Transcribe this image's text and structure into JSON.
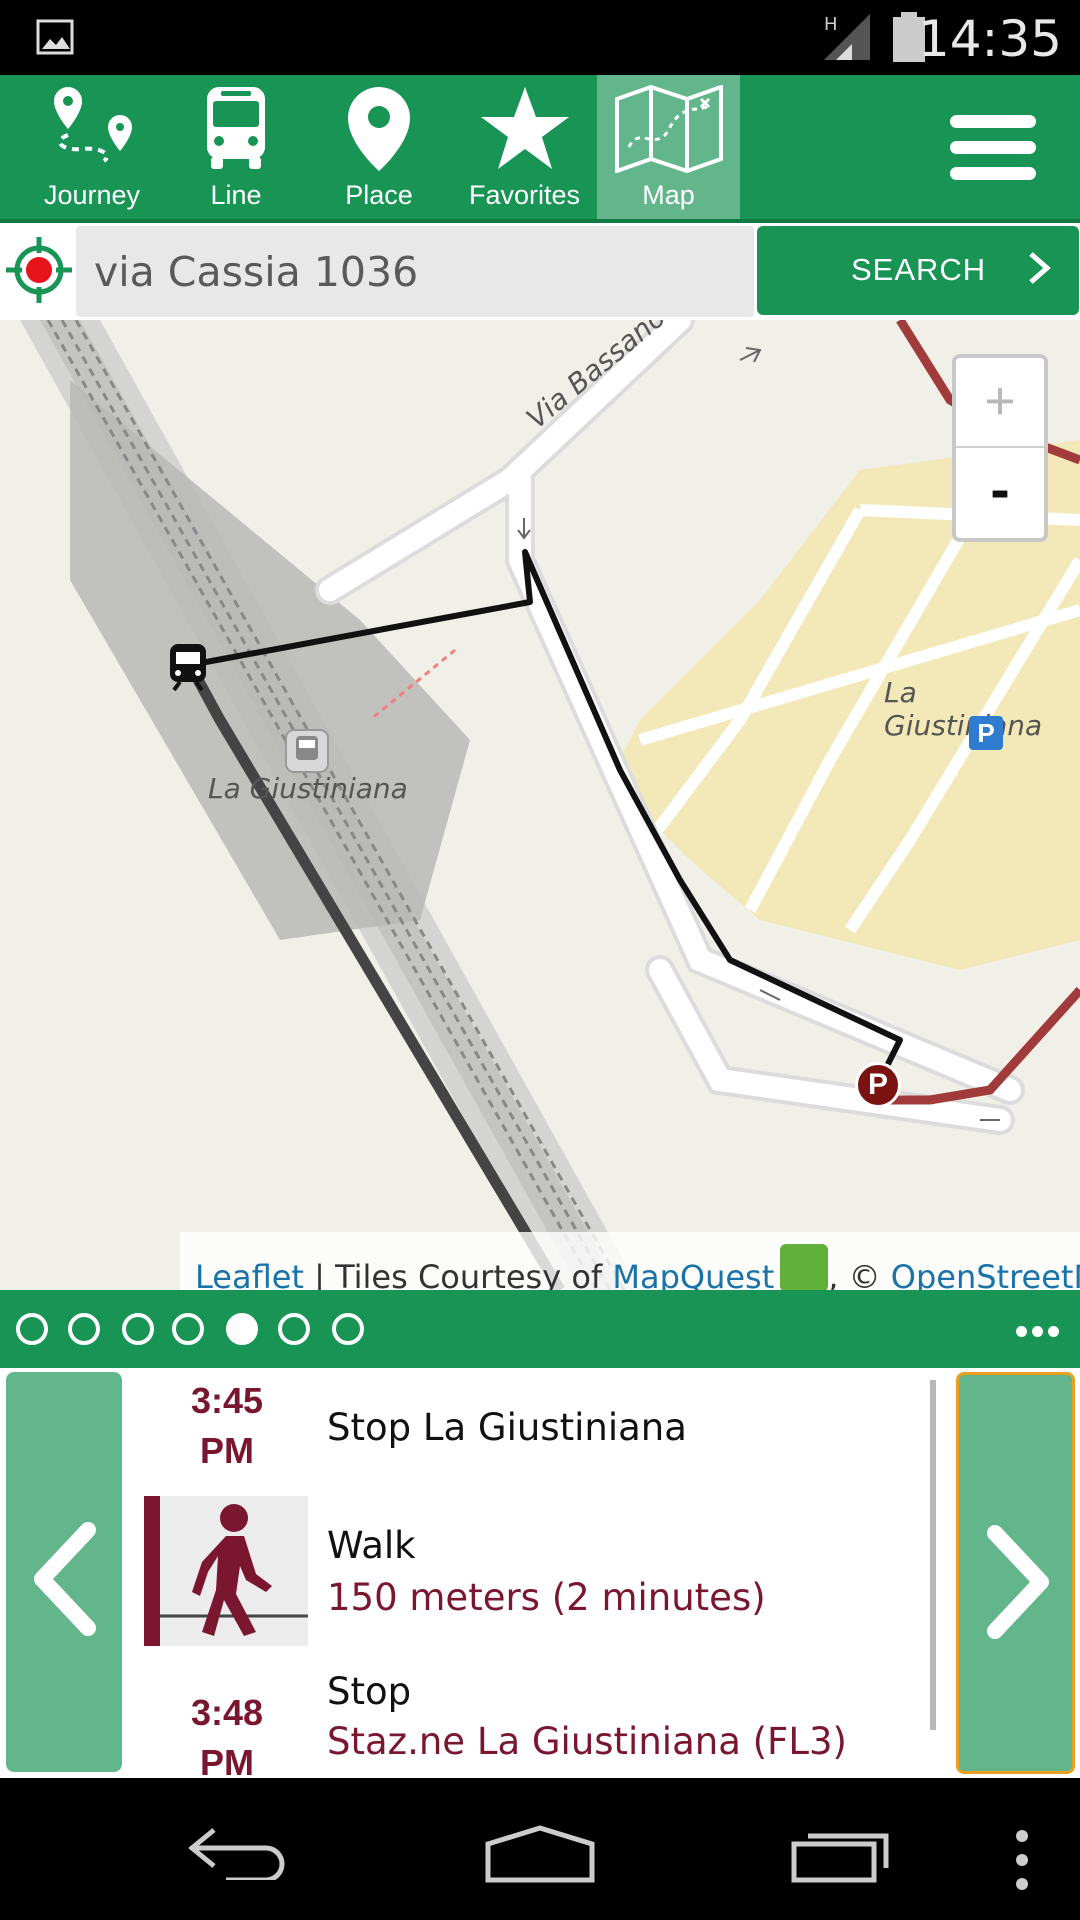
{
  "status_bar": {
    "time": "14:35",
    "icons": [
      "image-icon",
      "signal-icon",
      "battery-icon"
    ]
  },
  "top_nav": {
    "items": [
      {
        "label": "Journey",
        "icon": "journey-icon"
      },
      {
        "label": "Line",
        "icon": "bus-icon"
      },
      {
        "label": "Place",
        "icon": "place-pin-icon"
      },
      {
        "label": "Favorites",
        "icon": "star-icon"
      },
      {
        "label": "Map",
        "icon": "map-icon",
        "active": true
      }
    ],
    "menu_icon": "hamburger-menu-icon"
  },
  "search": {
    "value": "via Cassia 1036",
    "button_label": "SEARCH"
  },
  "map": {
    "labels": {
      "street": "Via Bassano",
      "station": "La Giustiniana",
      "parking_area": "La Giustiniana"
    },
    "zoom_in": "+",
    "zoom_out": "-",
    "attribution": {
      "leaflet": "Leaflet",
      "sep": " | Tiles Courtesy of ",
      "mapquest": "MapQuest",
      "copy": ", © ",
      "osm": "OpenStreetMap"
    },
    "markers": {
      "train": "T",
      "parking_pin": "P",
      "parking_sign": "P"
    }
  },
  "pager": {
    "pages": 7,
    "current_index": 4
  },
  "itinerary": {
    "steps": [
      {
        "time": "3:45",
        "ampm": "PM",
        "title": "Stop La Giustiniana"
      },
      {
        "title": "Walk",
        "subtitle": "150 meters (2 minutes)"
      },
      {
        "time": "3:48",
        "ampm": "PM",
        "title": "Stop",
        "subtitle": "Staz.ne La Giustiniana (FL3)"
      }
    ]
  },
  "colors": {
    "brand_green": "#189454",
    "active_green": "#63b68c",
    "maroon": "#7b1630"
  }
}
